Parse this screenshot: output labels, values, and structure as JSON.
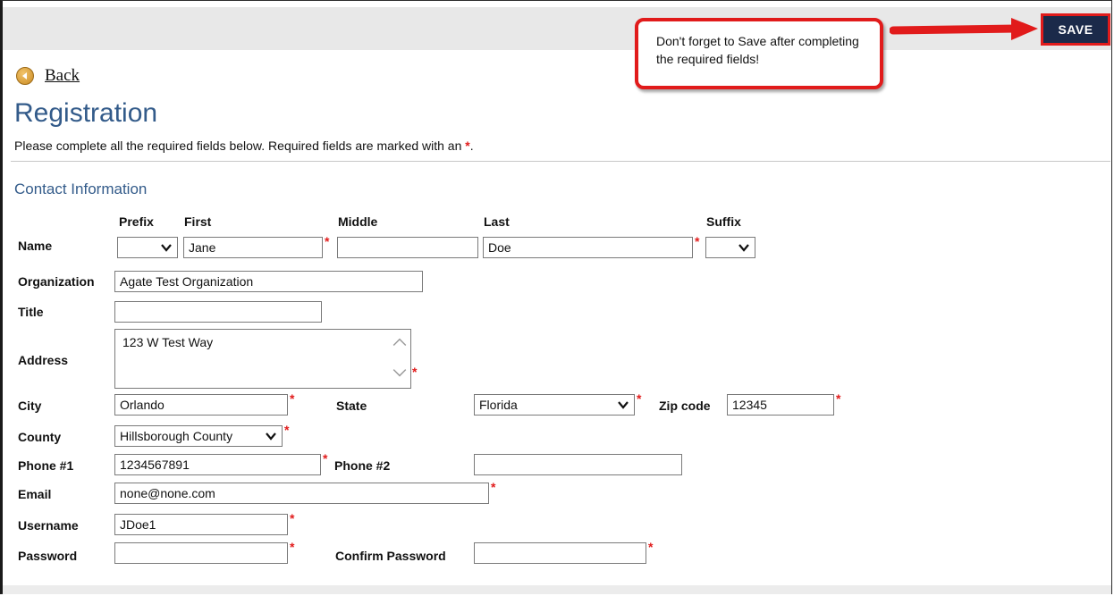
{
  "header": {
    "save_label": "SAVE"
  },
  "callout": {
    "text": "Don't forget to Save after completing the required fields!"
  },
  "nav": {
    "back_label": "Back"
  },
  "page": {
    "title": "Registration",
    "instructions": "Please complete all the required fields below. Required fields are marked with an",
    "required_marker": "*",
    "instructions_end": "."
  },
  "section": {
    "title": "Contact Information"
  },
  "name_columns": {
    "prefix": "Prefix",
    "first": "First",
    "middle": "Middle",
    "last": "Last",
    "suffix": "Suffix"
  },
  "labels": {
    "name": "Name",
    "organization": "Organization",
    "title": "Title",
    "address": "Address",
    "city": "City",
    "state": "State",
    "zip": "Zip code",
    "county": "County",
    "phone1": "Phone #1",
    "phone2": "Phone #2",
    "email": "Email",
    "username": "Username",
    "password": "Password",
    "confirm_password": "Confirm Password"
  },
  "values": {
    "prefix": "",
    "first": "Jane",
    "middle": "",
    "last": "Doe",
    "suffix": "",
    "organization": "Agate Test Organization",
    "title": "",
    "address": "123 W Test Way",
    "city": "Orlando",
    "state": "Florida",
    "zip": "12345",
    "county": "Hillsborough County",
    "phone1": "1234567891",
    "phone2": "",
    "email": "none@none.com",
    "username": "JDoe1",
    "password": "",
    "confirm_password": ""
  },
  "colors": {
    "accent": "#335b8a",
    "required": "#e11b1b",
    "save_bg": "#1b2a4a"
  }
}
